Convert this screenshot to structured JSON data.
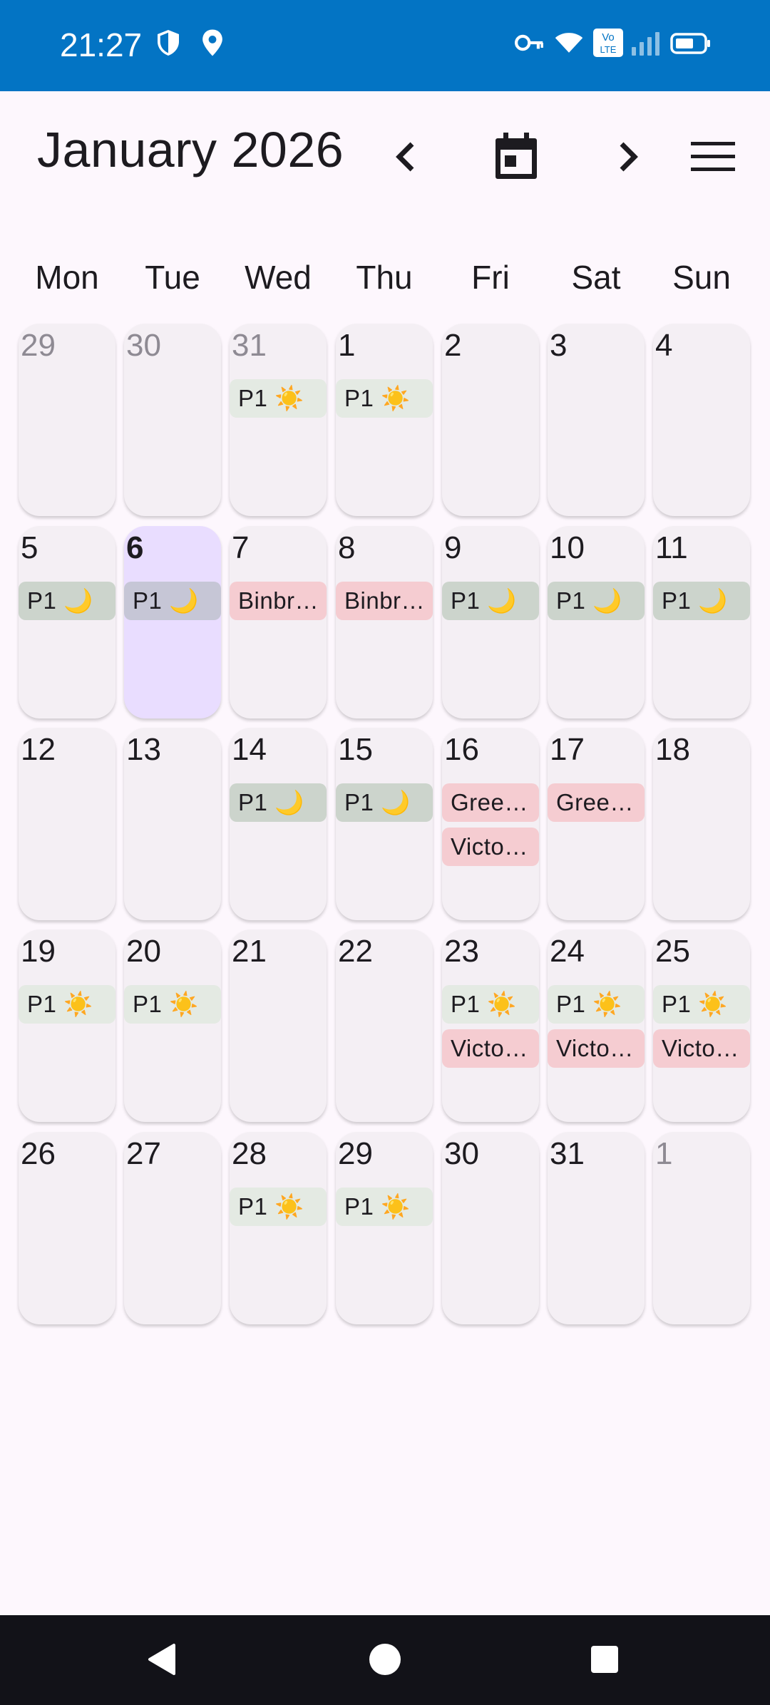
{
  "status_bar": {
    "time": "21:27",
    "left_icons": [
      "shield-icon",
      "location-icon"
    ],
    "right_icons": [
      "vpn-key-icon",
      "wifi-icon",
      "volte-icon",
      "signal-icon",
      "battery-icon"
    ],
    "volte_top": "Vo",
    "volte_bottom": "LTE",
    "background": "#0374C4"
  },
  "header": {
    "title": "January 2026",
    "prev_icon": "chevron-left-icon",
    "today_icon": "calendar-today-icon",
    "next_icon": "chevron-right-icon",
    "menu_icon": "menu-icon"
  },
  "weekdays": [
    "Mon",
    "Tue",
    "Wed",
    "Thu",
    "Fri",
    "Sat",
    "Sun"
  ],
  "weeks": [
    [
      {
        "day": "29",
        "muted": true,
        "chips": []
      },
      {
        "day": "30",
        "muted": true,
        "chips": []
      },
      {
        "day": "31",
        "muted": true,
        "chips": [
          {
            "label": "P1 ☀️",
            "kind": "day"
          }
        ]
      },
      {
        "day": "1",
        "chips": [
          {
            "label": "P1 ☀️",
            "kind": "day"
          }
        ]
      },
      {
        "day": "2",
        "chips": []
      },
      {
        "day": "3",
        "chips": []
      },
      {
        "day": "4",
        "chips": []
      }
    ],
    [
      {
        "day": "5",
        "chips": [
          {
            "label": "P1 🌙",
            "kind": "night"
          }
        ]
      },
      {
        "day": "6",
        "today": true,
        "chips": [
          {
            "label": "P1 🌙",
            "kind": "night"
          }
        ]
      },
      {
        "day": "7",
        "chips": [
          {
            "label": "Binbr…",
            "kind": "event"
          }
        ]
      },
      {
        "day": "8",
        "chips": [
          {
            "label": "Binbr…",
            "kind": "event"
          }
        ]
      },
      {
        "day": "9",
        "chips": [
          {
            "label": "P1 🌙",
            "kind": "night"
          }
        ]
      },
      {
        "day": "10",
        "chips": [
          {
            "label": "P1 🌙",
            "kind": "night"
          }
        ]
      },
      {
        "day": "11",
        "chips": [
          {
            "label": "P1 🌙",
            "kind": "night"
          }
        ]
      }
    ],
    [
      {
        "day": "12",
        "chips": []
      },
      {
        "day": "13",
        "chips": []
      },
      {
        "day": "14",
        "chips": [
          {
            "label": "P1 🌙",
            "kind": "night"
          }
        ]
      },
      {
        "day": "15",
        "chips": [
          {
            "label": "P1 🌙",
            "kind": "night"
          }
        ]
      },
      {
        "day": "16",
        "chips": [
          {
            "label": "Gree…",
            "kind": "event"
          },
          {
            "label": "Victo…",
            "kind": "event"
          }
        ]
      },
      {
        "day": "17",
        "chips": [
          {
            "label": "Gree…",
            "kind": "event"
          }
        ]
      },
      {
        "day": "18",
        "chips": []
      }
    ],
    [
      {
        "day": "19",
        "chips": [
          {
            "label": "P1 ☀️",
            "kind": "day"
          }
        ]
      },
      {
        "day": "20",
        "chips": [
          {
            "label": "P1 ☀️",
            "kind": "day"
          }
        ]
      },
      {
        "day": "21",
        "chips": []
      },
      {
        "day": "22",
        "chips": []
      },
      {
        "day": "23",
        "chips": [
          {
            "label": "P1 ☀️",
            "kind": "day"
          },
          {
            "label": "Victo…",
            "kind": "event"
          }
        ]
      },
      {
        "day": "24",
        "chips": [
          {
            "label": "P1 ☀️",
            "kind": "day"
          },
          {
            "label": "Victo…",
            "kind": "event"
          }
        ]
      },
      {
        "day": "25",
        "chips": [
          {
            "label": "P1 ☀️",
            "kind": "day"
          },
          {
            "label": "Victo…",
            "kind": "event"
          }
        ]
      }
    ],
    [
      {
        "day": "26",
        "chips": []
      },
      {
        "day": "27",
        "chips": []
      },
      {
        "day": "28",
        "chips": [
          {
            "label": "P1 ☀️",
            "kind": "day"
          }
        ]
      },
      {
        "day": "29",
        "chips": [
          {
            "label": "P1 ☀️",
            "kind": "day"
          }
        ]
      },
      {
        "day": "30",
        "chips": []
      },
      {
        "day": "31",
        "chips": []
      },
      {
        "day": "1",
        "muted": true,
        "chips": []
      }
    ]
  ],
  "nav_bar": {
    "back_icon": "back-triangle-icon",
    "home_icon": "home-circle-icon",
    "recents_icon": "recents-square-icon"
  }
}
